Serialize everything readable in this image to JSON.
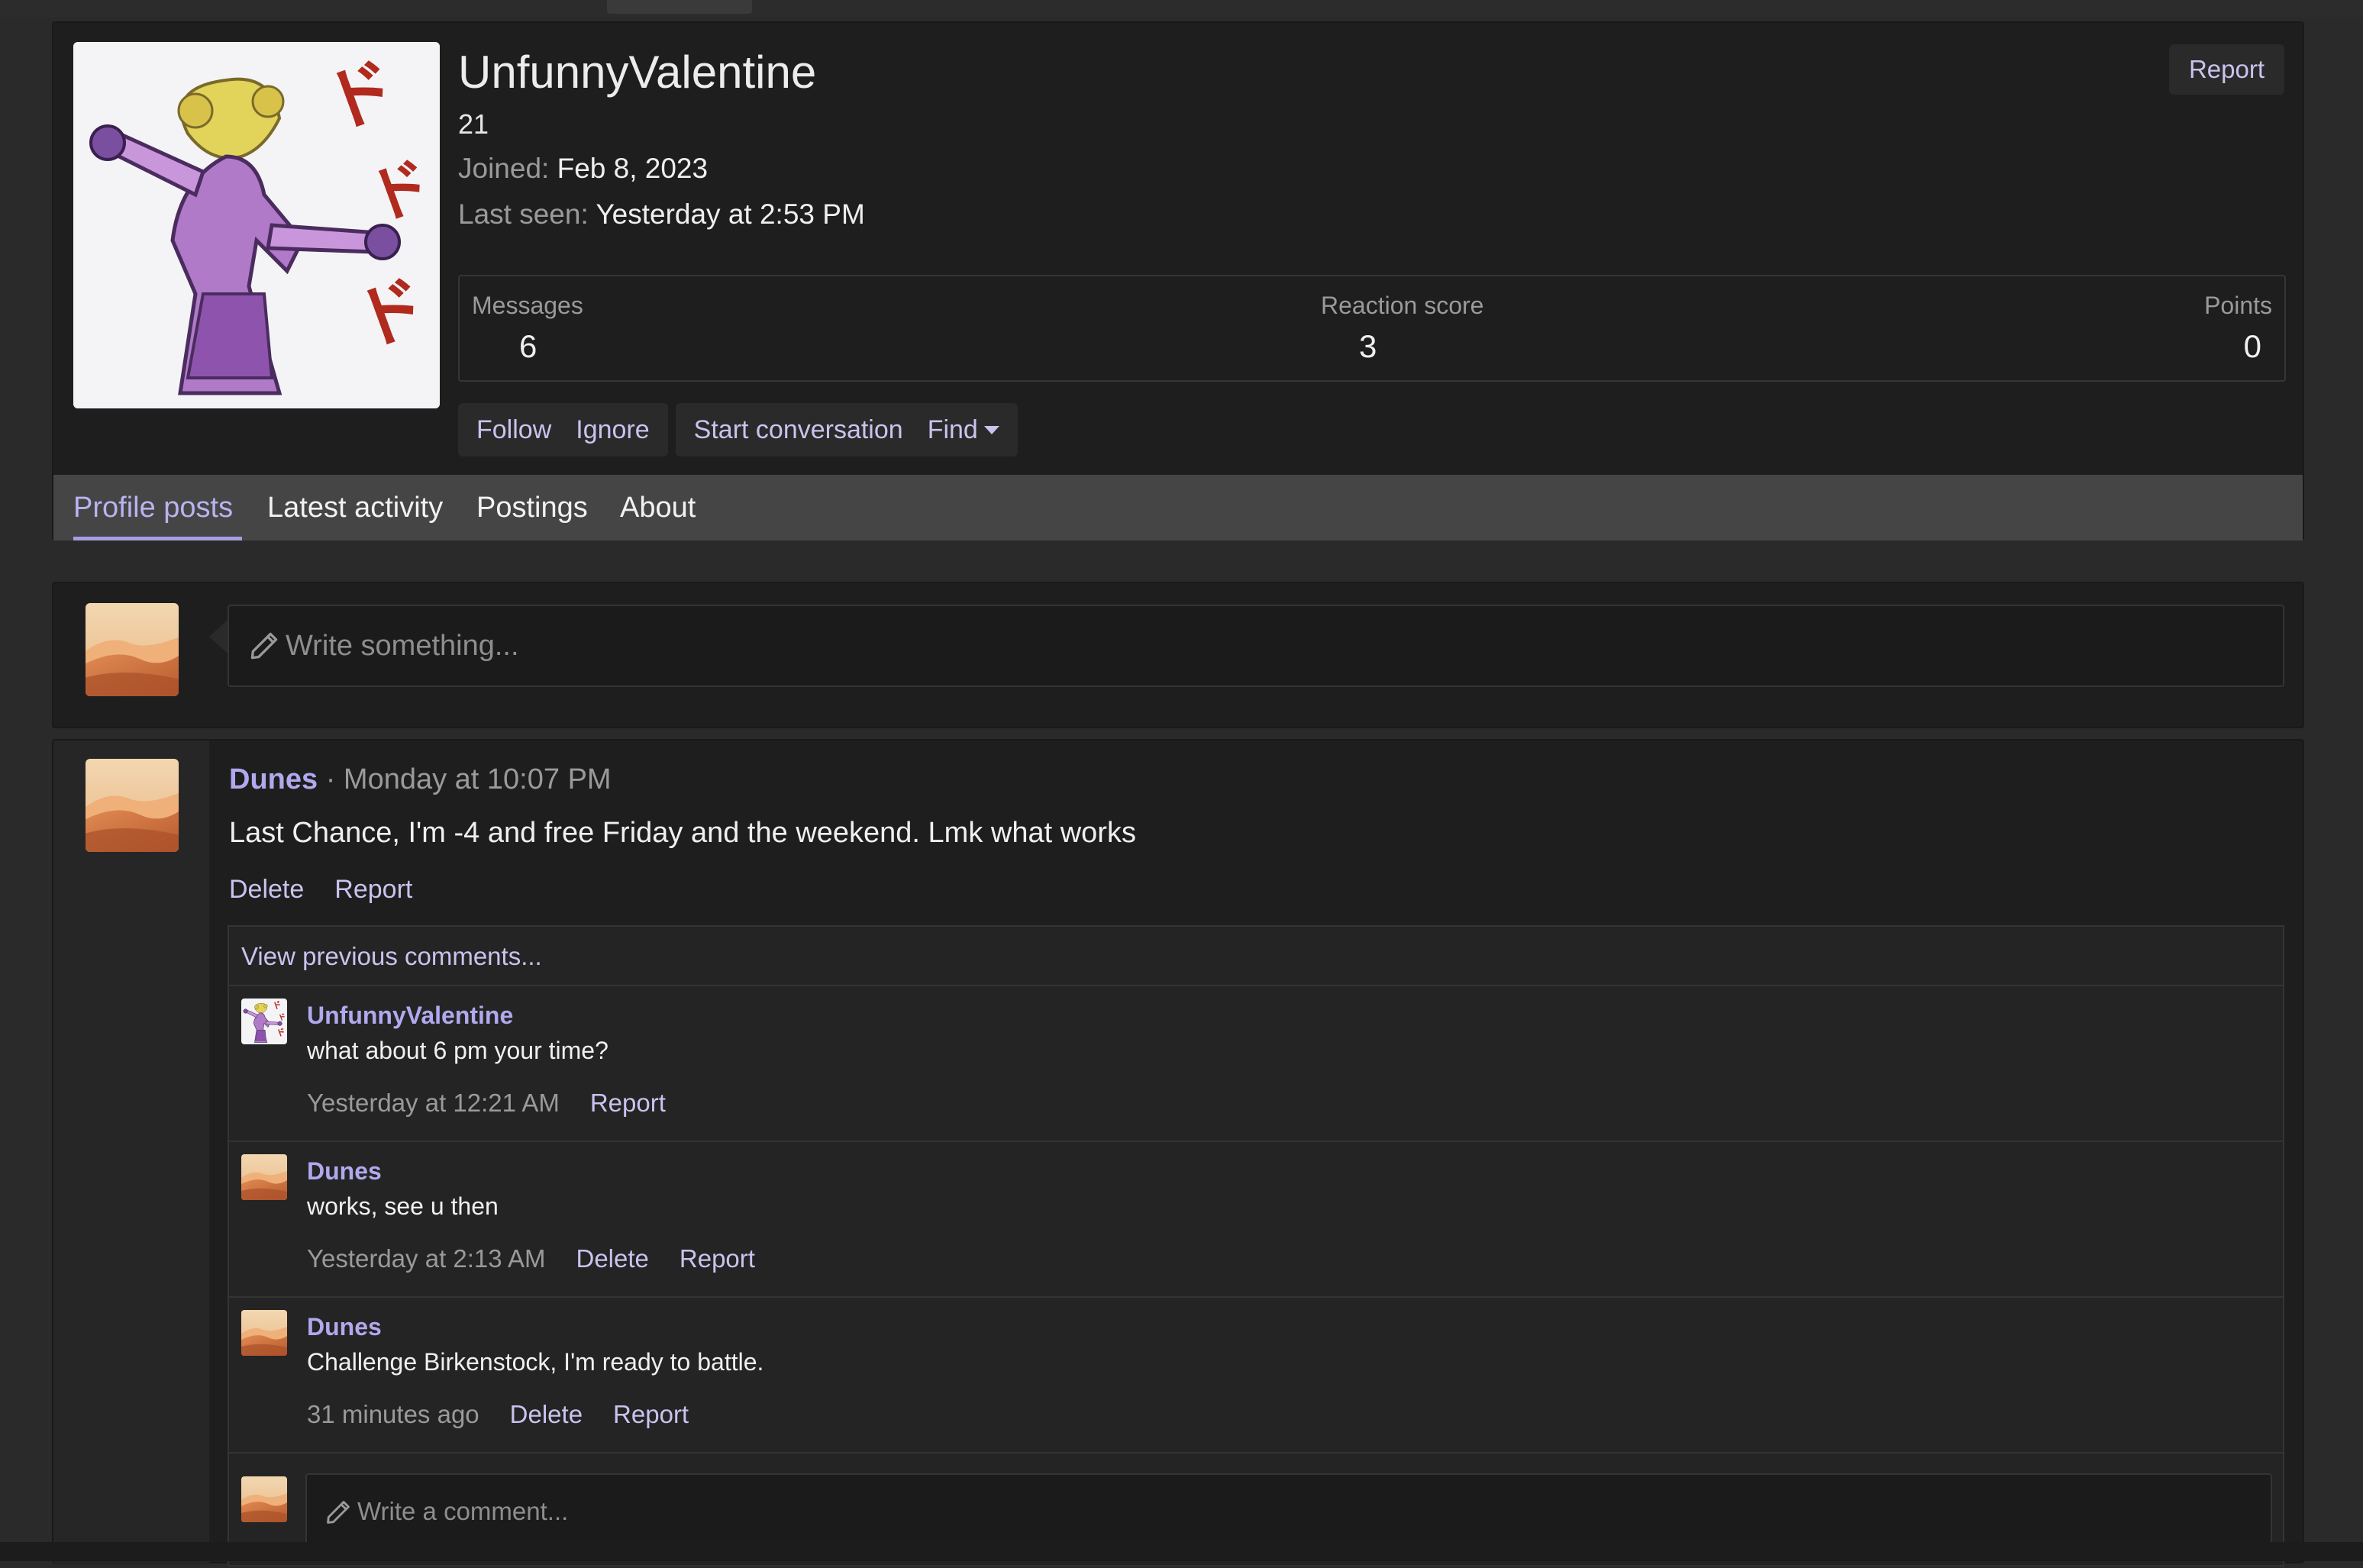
{
  "profile": {
    "username": "UnfunnyValentine",
    "age": "21",
    "joined_label": "Joined:",
    "joined_value": "Feb 8, 2023",
    "last_seen_label": "Last seen:",
    "last_seen_value": "Yesterday at 2:53 PM",
    "report_label": "Report",
    "stats": {
      "messages_label": "Messages",
      "messages_value": "6",
      "reaction_label": "Reaction score",
      "reaction_value": "3",
      "points_label": "Points",
      "points_value": "0"
    },
    "actions": {
      "follow": "Follow",
      "ignore": "Ignore",
      "start_conversation": "Start conversation",
      "find": "Find"
    },
    "tabs": [
      "Profile posts",
      "Latest activity",
      "Postings",
      "About"
    ],
    "active_tab": "Profile posts"
  },
  "composer": {
    "placeholder": "Write something..."
  },
  "post": {
    "author": "Dunes",
    "separator": "·",
    "time": "Monday at 10:07 PM",
    "text": "Last Chance, I'm -4 and free Friday and the weekend. Lmk what works",
    "delete_label": "Delete",
    "report_label": "Report",
    "view_previous": "View previous comments...",
    "comments": [
      {
        "author": "UnfunnyValentine",
        "text": "what about 6 pm your time?",
        "time": "Yesterday at 12:21 AM",
        "actions": [
          "Report"
        ]
      },
      {
        "author": "Dunes",
        "text": "works, see u then",
        "time": "Yesterday at 2:13 AM",
        "actions": [
          "Delete",
          "Report"
        ]
      },
      {
        "author": "Dunes",
        "text": "Challenge Birkenstock, I'm ready to battle.",
        "time": "31 minutes ago",
        "actions": [
          "Delete",
          "Report"
        ]
      }
    ],
    "comment_placeholder": "Write a comment..."
  },
  "colors": {
    "accent": "#b1a9ee",
    "link": "#c9c3ee",
    "background": "#2a2a2a",
    "panel": "#1e1e1e",
    "tab_bar": "#454545"
  },
  "icons": [
    "pencil-icon",
    "caret-down-icon"
  ]
}
